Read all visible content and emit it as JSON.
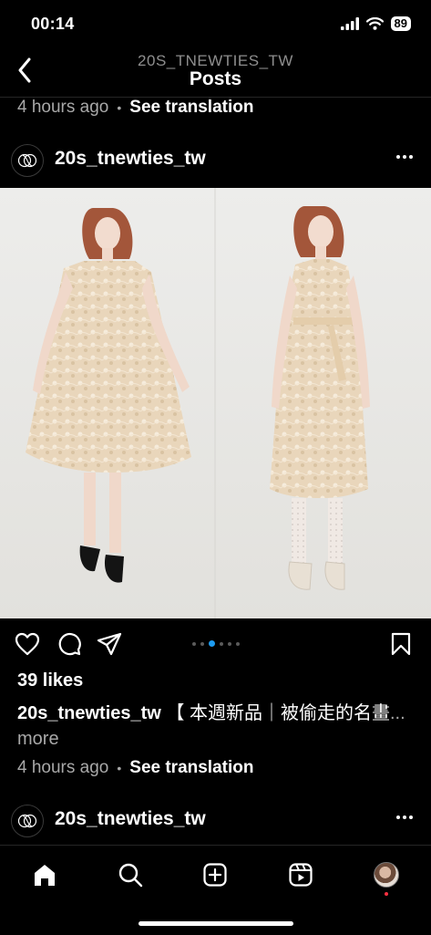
{
  "status_bar": {
    "time": "00:14",
    "battery": "89"
  },
  "header": {
    "account": "20S_TNEWTIES_TW",
    "title": "Posts"
  },
  "prev_post": {
    "time": "4 hours ago",
    "see_translation": "See translation"
  },
  "post": {
    "username": "20s_tnewties_tw",
    "likes": "39 likes",
    "caption_user": "20s_tnewties_tw",
    "caption_text": "【 本週新品｜被偷走的名畫",
    "caption_more": "... more",
    "time": "4 hours ago",
    "see_translation": "See translation",
    "carousel": {
      "count": 6,
      "active_index": 2
    }
  },
  "next_post": {
    "username": "20s_tnewties_tw"
  },
  "tabs": [
    "home-icon",
    "search-icon",
    "create-icon",
    "reels-icon",
    "profile-avatar"
  ]
}
